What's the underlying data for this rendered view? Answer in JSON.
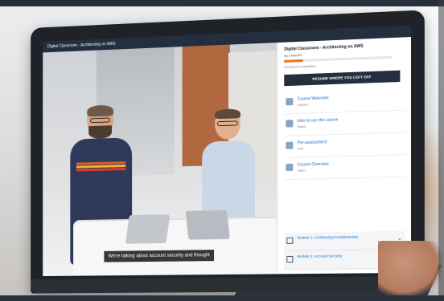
{
  "topbar_title": "Digital Classroom - Architecting on AWS",
  "video_caption": "We're talking about account security and thought",
  "panel": {
    "title": "Digital Classroom - Architecting on AWS",
    "subtitle": "By LADEEB",
    "progress_fraction": 0.18,
    "progress_text": "16 lessons completed",
    "resume_label": "RESUME WHERE YOU LEFT OFF",
    "lessons": [
      {
        "title": "Course Welcome",
        "type": "Lesson"
      },
      {
        "title": "Intro to use the course",
        "type": "Video"
      },
      {
        "title": "Pre-assessment",
        "type": "Test"
      },
      {
        "title": "Course Overview",
        "type": "Video"
      }
    ],
    "modules": [
      {
        "title": "Module 1: Architecting Fundamentals"
      },
      {
        "title": "Module 2: Account Security"
      }
    ]
  }
}
